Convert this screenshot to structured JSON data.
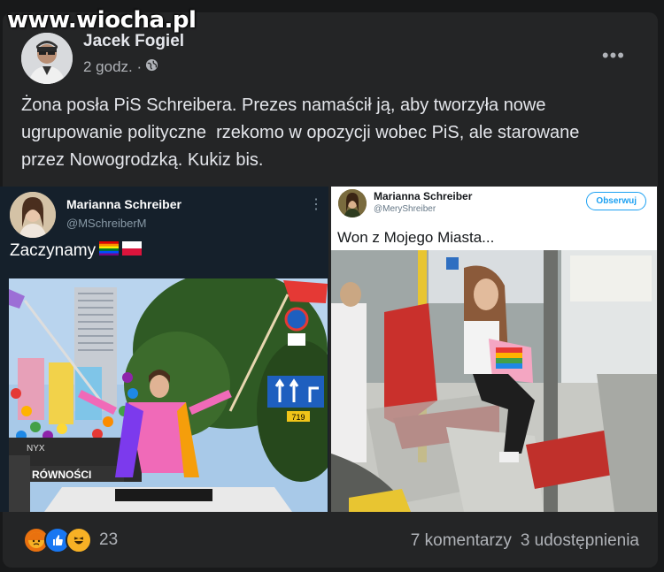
{
  "watermark": "www.wiocha.pl",
  "post": {
    "author": "Jacek Fogiel",
    "time": "2 godz. ·",
    "privacy_icon": "globe-icon",
    "text_lines": [
      "Żona posła PiS Schreibera. Prezes namaścił ją, aby tworzyła nowe",
      "ugrupowanie polityczne  rzekomo w opozycji wobec PiS, ale starowane",
      "przez Nowogrodzką. Kukiz bis."
    ]
  },
  "tweet_left": {
    "name": "Marianna Schreiber",
    "handle": "@MSchreiberM",
    "text": "Zaczynamy",
    "photo_sign_text": "RÓWNOŚCI",
    "photo_banner_text": "NYX",
    "road_sign_number": "719"
  },
  "tweet_right": {
    "name": "Marianna Schreiber",
    "handle": "@MeryShreiber",
    "follow_label": "Obserwuj",
    "text": "Won z Mojego Miasta..."
  },
  "footer": {
    "reaction_icons": [
      "angry-icon",
      "like-icon",
      "haha-icon"
    ],
    "reaction_count": "23",
    "comments": "7 komentarzy",
    "shares": "3 udostępnienia"
  },
  "colors": {
    "background": "#18191a",
    "card": "#242526",
    "text_primary": "#e4e6eb",
    "text_secondary": "#b0b3b8",
    "twitter_blue": "#1da1f2"
  }
}
